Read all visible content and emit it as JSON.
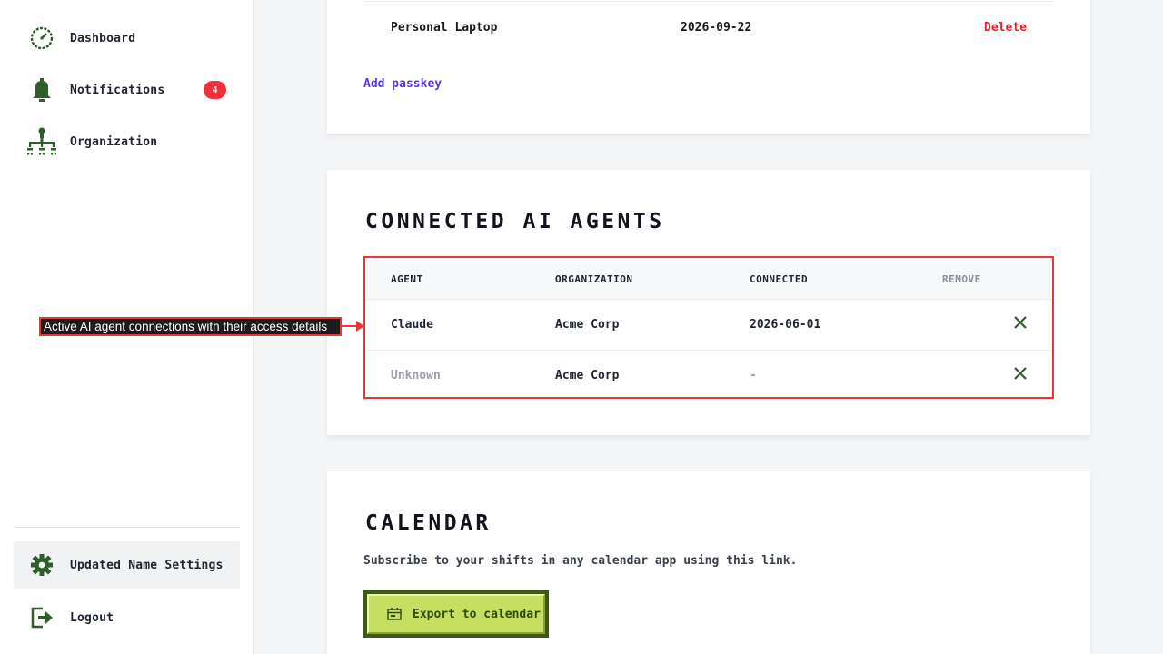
{
  "sidebar": {
    "items": [
      {
        "label": "Dashboard",
        "icon": "dashboard-icon"
      },
      {
        "label": "Notifications",
        "icon": "bell-icon",
        "badge": "4"
      },
      {
        "label": "Organization",
        "icon": "org-chart-icon"
      }
    ],
    "bottom": [
      {
        "label": "Updated Name Settings",
        "icon": "gear-icon",
        "active": true
      },
      {
        "label": "Logout",
        "icon": "logout-icon"
      }
    ]
  },
  "passkeys": {
    "row": {
      "name": "Personal Laptop",
      "date": "2026-09-22",
      "action": "Delete"
    },
    "add_label": "Add passkey"
  },
  "agents": {
    "title": "CONNECTED AI AGENTS",
    "columns": [
      "AGENT",
      "ORGANIZATION",
      "CONNECTED",
      "REMOVE"
    ],
    "rows": [
      {
        "agent": "Claude",
        "organization": "Acme Corp",
        "connected": "2026-06-01"
      },
      {
        "agent": "Unknown",
        "organization": "Acme Corp",
        "connected": "-"
      }
    ]
  },
  "annotation": {
    "text": "Active AI agent connections with their access details"
  },
  "calendar": {
    "title": "CALENDAR",
    "description": "Subscribe to your shifts in any calendar app using this link.",
    "button_label": "Export to calendar"
  },
  "colors": {
    "accent_green": "#2e5e2a",
    "danger": "#f0202a",
    "link": "#5a35e6",
    "highlight": "#e53935",
    "button_fill": "#c6df63"
  }
}
